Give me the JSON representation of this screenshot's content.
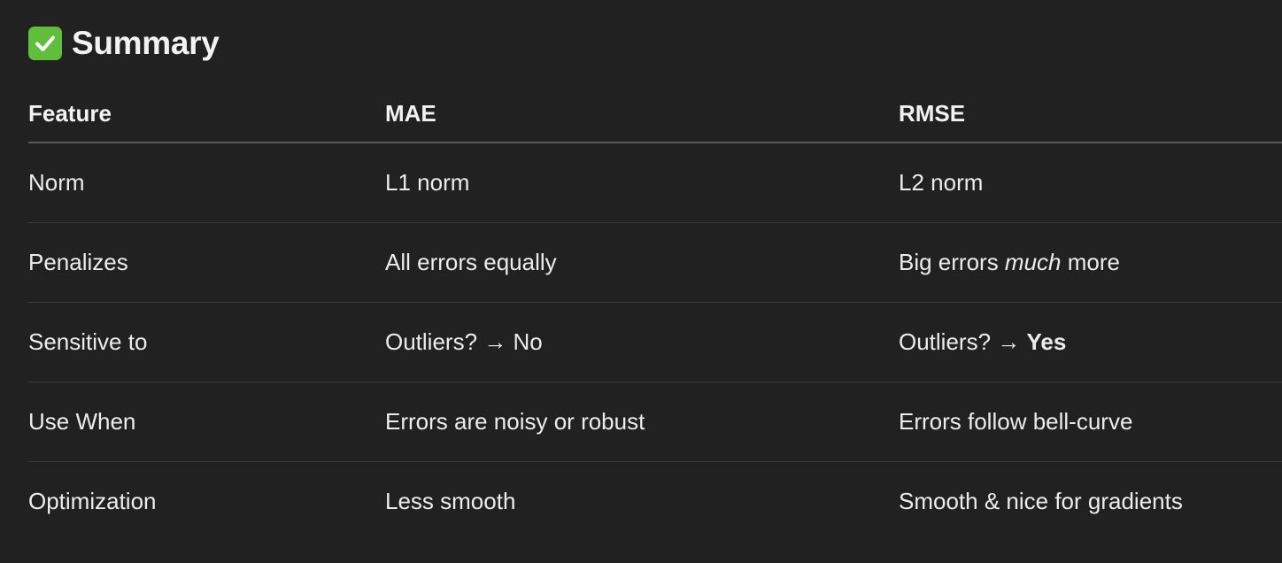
{
  "heading": {
    "icon": "check-mark-button-icon",
    "icon_color": "#5fbf3a",
    "title": "Summary"
  },
  "table": {
    "headers": [
      "Feature",
      "MAE",
      "RMSE"
    ],
    "rows": [
      {
        "feature": "Norm",
        "mae": "L1 norm",
        "rmse": "L2 norm"
      },
      {
        "feature": "Penalizes",
        "mae": "All errors equally",
        "rmse_pre": "Big errors ",
        "rmse_em": "much",
        "rmse_post": " more"
      },
      {
        "feature": "Sensitive to",
        "mae": "Outliers? → No",
        "rmse_pre": "Outliers? → ",
        "rmse_strong": "Yes"
      },
      {
        "feature": "Use When",
        "mae": "Errors are noisy or robust",
        "rmse": "Errors follow bell-curve"
      },
      {
        "feature": "Optimization",
        "mae": "Less smooth",
        "rmse": "Smooth & nice for gradients"
      }
    ]
  }
}
